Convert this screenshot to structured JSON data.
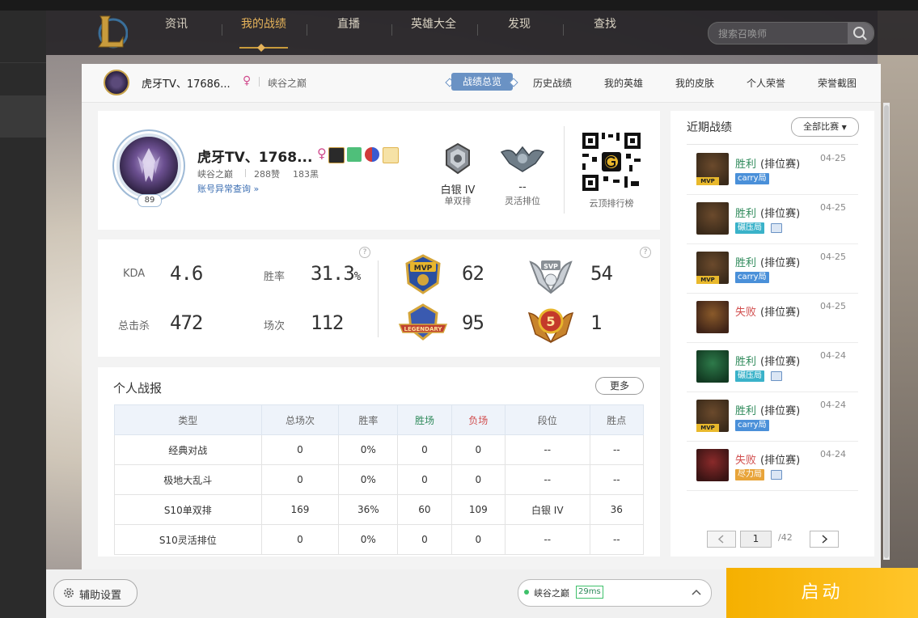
{
  "nav": {
    "items": [
      "资讯",
      "我的战绩",
      "直播",
      "英雄大全",
      "发现",
      "查找"
    ],
    "active_index": 1,
    "search_placeholder": "搜索召唤师"
  },
  "subheader": {
    "name": "虎牙TV、17686...",
    "server": "峡谷之巅",
    "tabs": [
      "战绩总览",
      "历史战绩",
      "我的英雄",
      "我的皮肤",
      "个人荣誉",
      "荣誉截图"
    ],
    "active_tab": "战绩总览"
  },
  "profile": {
    "name": "虎牙TV、1768...",
    "level": "89",
    "server": "峡谷之巅",
    "likes": "288赞",
    "blacks": "183黑",
    "abnormal_link": "账号异常查询 »",
    "solo_rank": "白银 IV",
    "solo_label": "单双排",
    "flex_rank": "--",
    "flex_label": "灵活排位",
    "qr_label": "云顶排行榜"
  },
  "stats": {
    "kda_label": "KDA",
    "kda": "4.6",
    "winrate_label": "胜率",
    "winrate": "31.3",
    "winrate_unit": "%",
    "kills_label": "总击杀",
    "kills": "472",
    "games_label": "场次",
    "games": "112",
    "mvp": "62",
    "svp": "54",
    "legendary": "95",
    "penta": "1",
    "help": "?"
  },
  "report": {
    "title": "个人战报",
    "more": "更多",
    "headers": [
      "类型",
      "总场次",
      "胜率",
      "胜场",
      "负场",
      "段位",
      "胜点"
    ],
    "rows": [
      [
        "经典对战",
        "0",
        "0%",
        "0",
        "0",
        "--",
        "--"
      ],
      [
        "极地大乱斗",
        "0",
        "0%",
        "0",
        "0",
        "--",
        "--"
      ],
      [
        "S10单双排",
        "169",
        "36%",
        "60",
        "109",
        "白银 IV",
        "36"
      ],
      [
        "S10灵活排位",
        "0",
        "0%",
        "0",
        "0",
        "--",
        "--"
      ]
    ]
  },
  "matches": {
    "title": "近期战绩",
    "filter": "全部比赛",
    "list": [
      {
        "result": "胜利",
        "mode": "(排位赛)",
        "date": "04-25",
        "tag": "carry局",
        "tag_color": "#4a90d9",
        "mvp": true,
        "img": false
      },
      {
        "result": "胜利",
        "mode": "(排位赛)",
        "date": "04-25",
        "tag": "碾压局",
        "tag_color": "#3ab2c9",
        "mvp": false,
        "img": true
      },
      {
        "result": "胜利",
        "mode": "(排位赛)",
        "date": "04-25",
        "tag": "carry局",
        "tag_color": "#4a90d9",
        "mvp": true,
        "img": false
      },
      {
        "result": "失败",
        "mode": "(排位赛)",
        "date": "04-25",
        "tag": "",
        "tag_color": "",
        "mvp": false,
        "img": false
      },
      {
        "result": "胜利",
        "mode": "(排位赛)",
        "date": "04-24",
        "tag": "碾压局",
        "tag_color": "#3ab2c9",
        "mvp": false,
        "img": true
      },
      {
        "result": "胜利",
        "mode": "(排位赛)",
        "date": "04-24",
        "tag": "carry局",
        "tag_color": "#4a90d9",
        "mvp": true,
        "img": false
      },
      {
        "result": "失败",
        "mode": "(排位赛)",
        "date": "04-24",
        "tag": "尽力局",
        "tag_color": "#e8a43a",
        "mvp": false,
        "img": true
      }
    ],
    "mvp_text": "MVP",
    "page": "1",
    "total": "/42"
  },
  "bottom": {
    "assist": "辅助设置",
    "server": "峡谷之巅",
    "ping": "29ms",
    "launch": "启动"
  },
  "colors": {
    "accent_gold": "#c89b3c",
    "win": "#2f8a5b",
    "loss": "#d14d4d",
    "tab_blue": "#6a92c4",
    "launch": "#f5b000"
  }
}
